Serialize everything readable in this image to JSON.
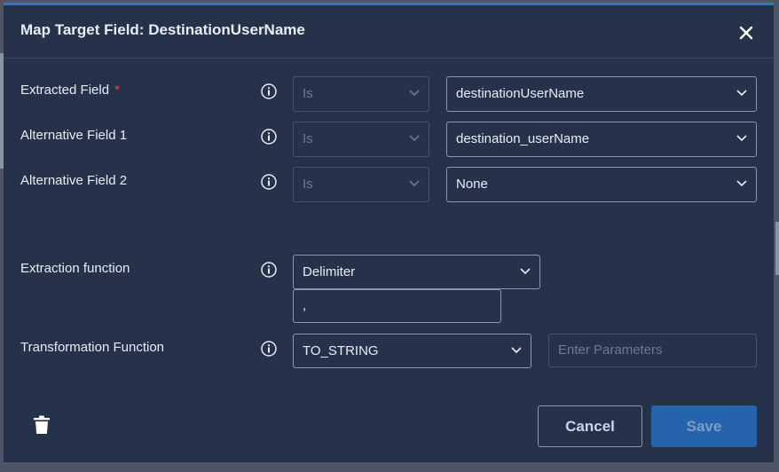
{
  "dialog": {
    "title": "Map Target Field: DestinationUserName"
  },
  "fields": {
    "extracted": {
      "label": "Extracted Field",
      "required_mark": "*",
      "operator": "Is",
      "value": "destinationUserName"
    },
    "alt1": {
      "label": "Alternative Field 1",
      "operator": "Is",
      "value": "destination_userName"
    },
    "alt2": {
      "label": "Alternative Field 2",
      "operator": "Is",
      "value": "None"
    },
    "extraction": {
      "label": "Extraction function",
      "function": "Delimiter",
      "delimiter_value": ","
    },
    "transformation": {
      "label": "Transformation Function",
      "function": "TO_STRING",
      "params_placeholder": "Enter Parameters"
    }
  },
  "footer": {
    "cancel_label": "Cancel",
    "save_label": "Save"
  },
  "colors": {
    "dialog_bg": "#25324a",
    "accent": "#2f76d2",
    "save_button": "#2563ad",
    "required": "#e5484d"
  },
  "icons": [
    "close-icon",
    "info-icon",
    "chevron-down-icon",
    "trash-icon"
  ]
}
